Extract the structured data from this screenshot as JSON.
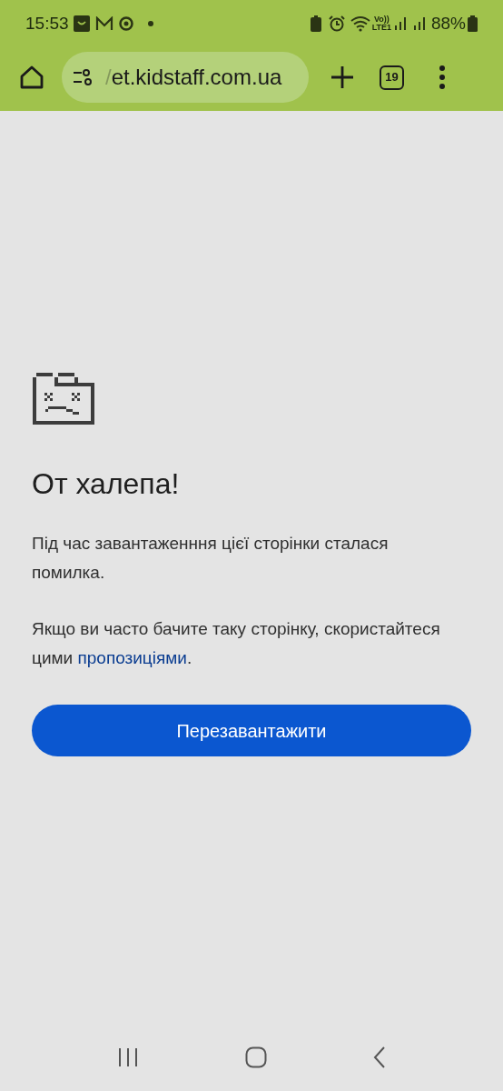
{
  "status_bar": {
    "time": "15:53",
    "network": "Vo))",
    "network_sub": "LTE1",
    "battery": "88%"
  },
  "toolbar": {
    "url_cut": "/",
    "url": "et.kidstaff.com.ua",
    "tab_count": "19"
  },
  "error": {
    "title": "От халепа!",
    "message": "Під час завантаженння цієї сторінки сталася помилка.",
    "hint_before": "Якщо ви часто бачите таку сторінку, скористайтеся цими ",
    "hint_link": "пропозиціями",
    "hint_after": ".",
    "button": "Перезавантажити"
  }
}
